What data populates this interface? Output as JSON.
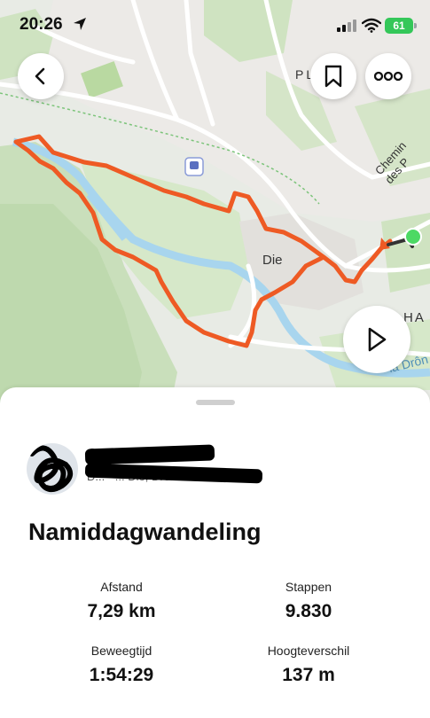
{
  "status_bar": {
    "time": "20:26",
    "battery": "61",
    "battery_color": "#34c759"
  },
  "map": {
    "labels": {
      "town": "Die",
      "street_1": "Chemin des P",
      "street_2": "PL",
      "street_3": "HA",
      "river": "la Drôn"
    },
    "route_color": "#ee5a24",
    "colors": {
      "land": "#e9ece6",
      "forest": "#cfe3c1",
      "urban": "#eceae6",
      "water": "#a8d5ee"
    }
  },
  "buttons": {
    "back": "chevron-left-icon",
    "save": "bookmark-icon",
    "more": "more-dots-icon",
    "play": "play-icon"
  },
  "author": {
    "name": "C",
    "subtitle": "D... · ... Die, Drôme"
  },
  "activity": {
    "title": "Namiddagwandeling",
    "stats": [
      {
        "label": "Afstand",
        "value": "7,29 km"
      },
      {
        "label": "Stappen",
        "value": "9.830"
      },
      {
        "label": "Beweegtijd",
        "value": "1:54:29"
      },
      {
        "label": "Hoogteverschil",
        "value": "137 m"
      }
    ]
  }
}
